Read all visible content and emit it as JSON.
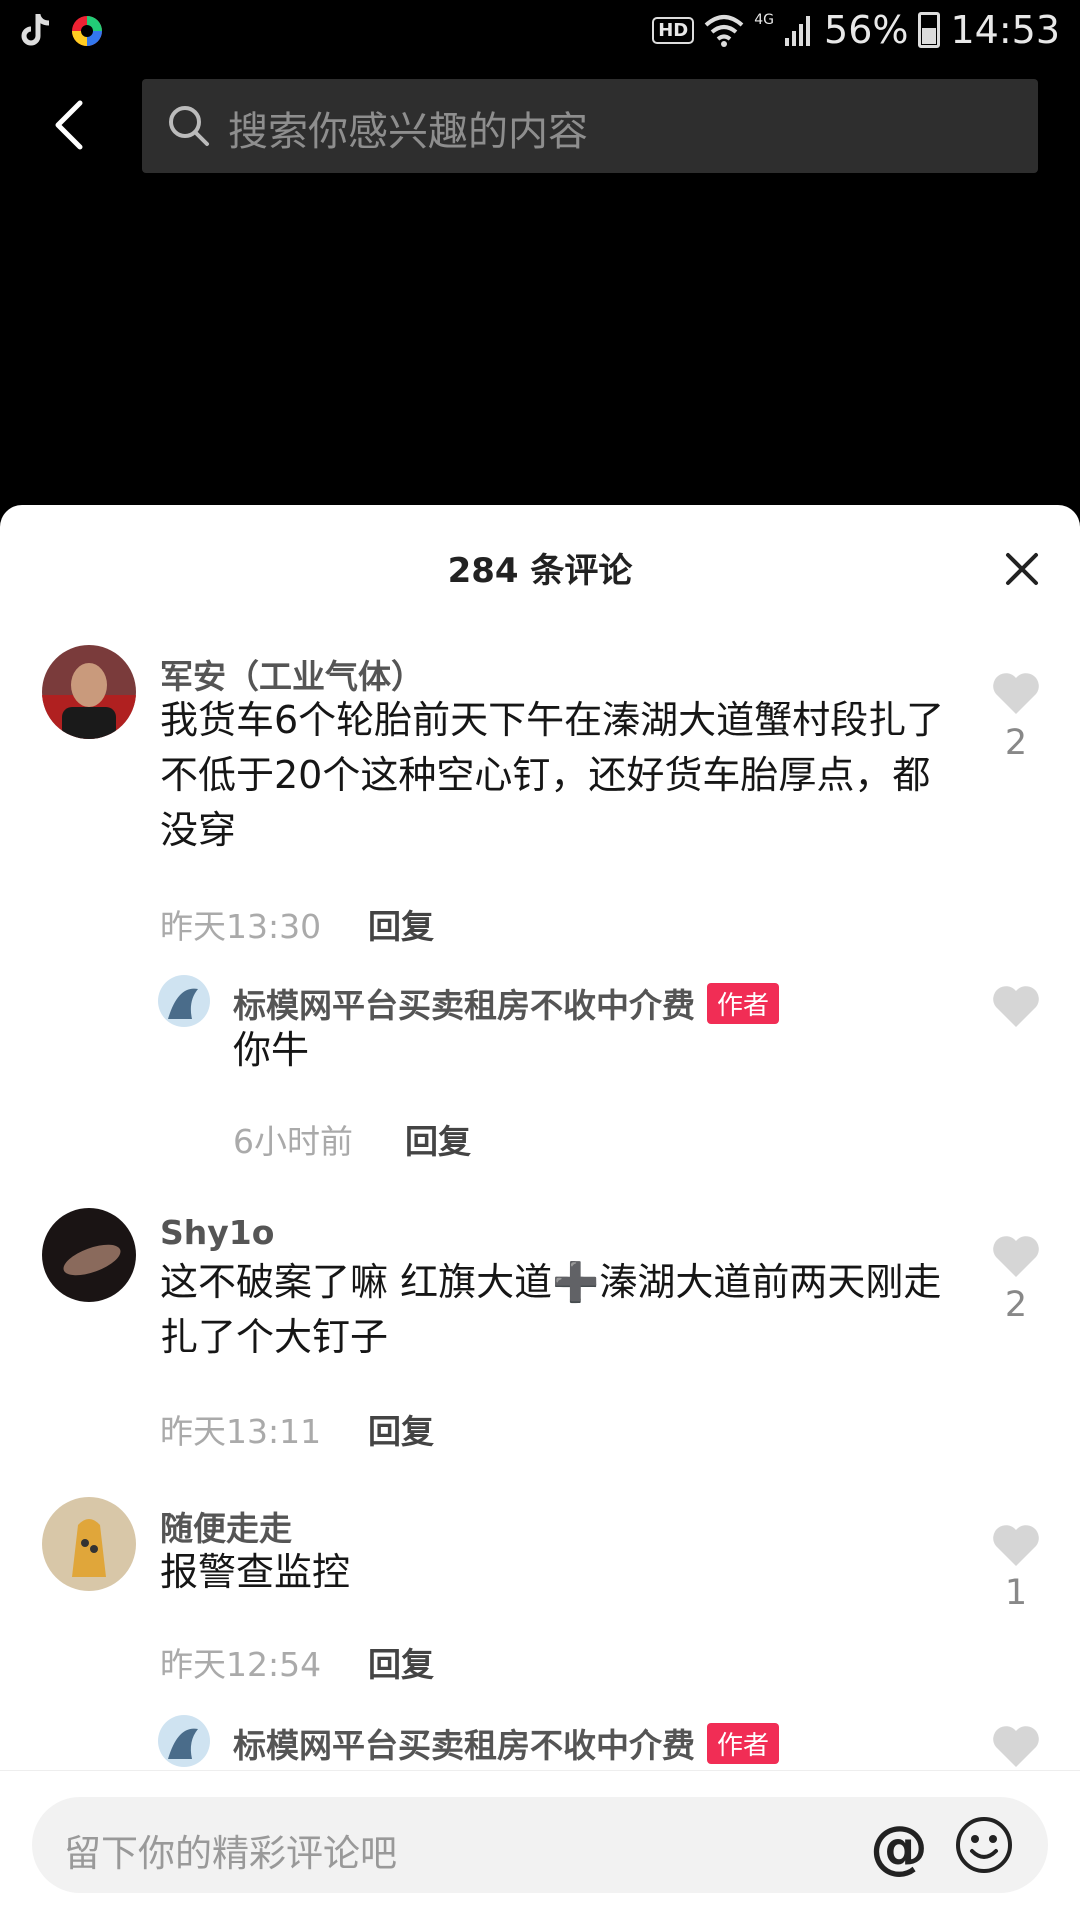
{
  "status": {
    "hd": "HD",
    "network": "4G",
    "battery": "56%",
    "time": "14:53"
  },
  "search": {
    "placeholder": "搜索你感兴趣的内容"
  },
  "sheet": {
    "title": "284 条评论"
  },
  "author_badge": "作者",
  "reply_label": "回复",
  "comments": [
    {
      "user": "军安（工业气体）",
      "text": "我货车6个轮胎前天下午在溱湖大道蟹村段扎了不低于20个这种空心钉，还好货车胎厚点，都没穿",
      "time": "昨天13:30",
      "likes": "2",
      "reply": {
        "user": "标模网平台买卖租房不收中介费",
        "text": "你牛",
        "time": "6小时前"
      }
    },
    {
      "user": "Shy1o",
      "text": "这不破案了嘛 红旗大道➕溱湖大道前两天刚走 扎了个大钉子",
      "time": "昨天13:11",
      "likes": "2"
    },
    {
      "user": "随便走走",
      "text": "报警查监控",
      "time": "昨天12:54",
      "likes": "1",
      "reply": {
        "user": "标模网平台买卖租房不收中介费"
      }
    }
  ],
  "input": {
    "placeholder": "留下你的精彩评论吧",
    "at": "@"
  },
  "colors": {
    "badge": "#f12d55",
    "sheet": "#ffffff",
    "like": "#d6d6d6"
  }
}
